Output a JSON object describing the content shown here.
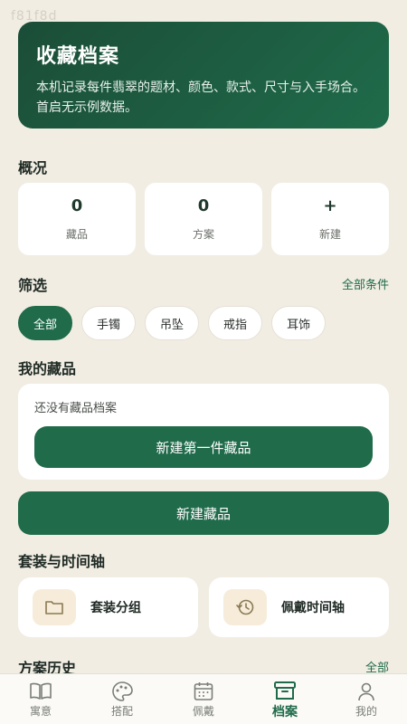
{
  "status_overlay": "f81f8d",
  "hero": {
    "title": "收藏档案",
    "description": "本机记录每件翡翠的题材、颜色、款式、尺寸与入手场合。首启无示例数据。"
  },
  "overview": {
    "title": "概况",
    "stats": [
      {
        "value": "0",
        "label": "藏品"
      },
      {
        "value": "0",
        "label": "方案"
      },
      {
        "value": "+",
        "label": "新建"
      }
    ]
  },
  "filter": {
    "title": "筛选",
    "all_conditions_link": "全部条件",
    "chips": [
      "全部",
      "手镯",
      "吊坠",
      "戒指",
      "耳饰"
    ],
    "active_chip": "全部"
  },
  "collection": {
    "title": "我的藏品",
    "empty_text": "还没有藏品档案",
    "create_first_button": "新建第一件藏品",
    "create_button": "新建藏品"
  },
  "sets": {
    "title": "套装与时间轴",
    "group_label": "套装分组",
    "timeline_label": "佩戴时间轴"
  },
  "history": {
    "title": "方案历史",
    "all_link": "全部"
  },
  "tabbar": {
    "items": [
      {
        "label": "寓意",
        "icon": "book-icon"
      },
      {
        "label": "搭配",
        "icon": "palette-icon"
      },
      {
        "label": "佩戴",
        "icon": "calendar-icon"
      },
      {
        "label": "档案",
        "icon": "archive-icon"
      },
      {
        "label": "我的",
        "icon": "user-icon"
      }
    ],
    "active": "档案"
  },
  "colors": {
    "accent": "#1f6b4a",
    "background": "#f1ede3",
    "icon_tile": "#f6ecd9"
  }
}
